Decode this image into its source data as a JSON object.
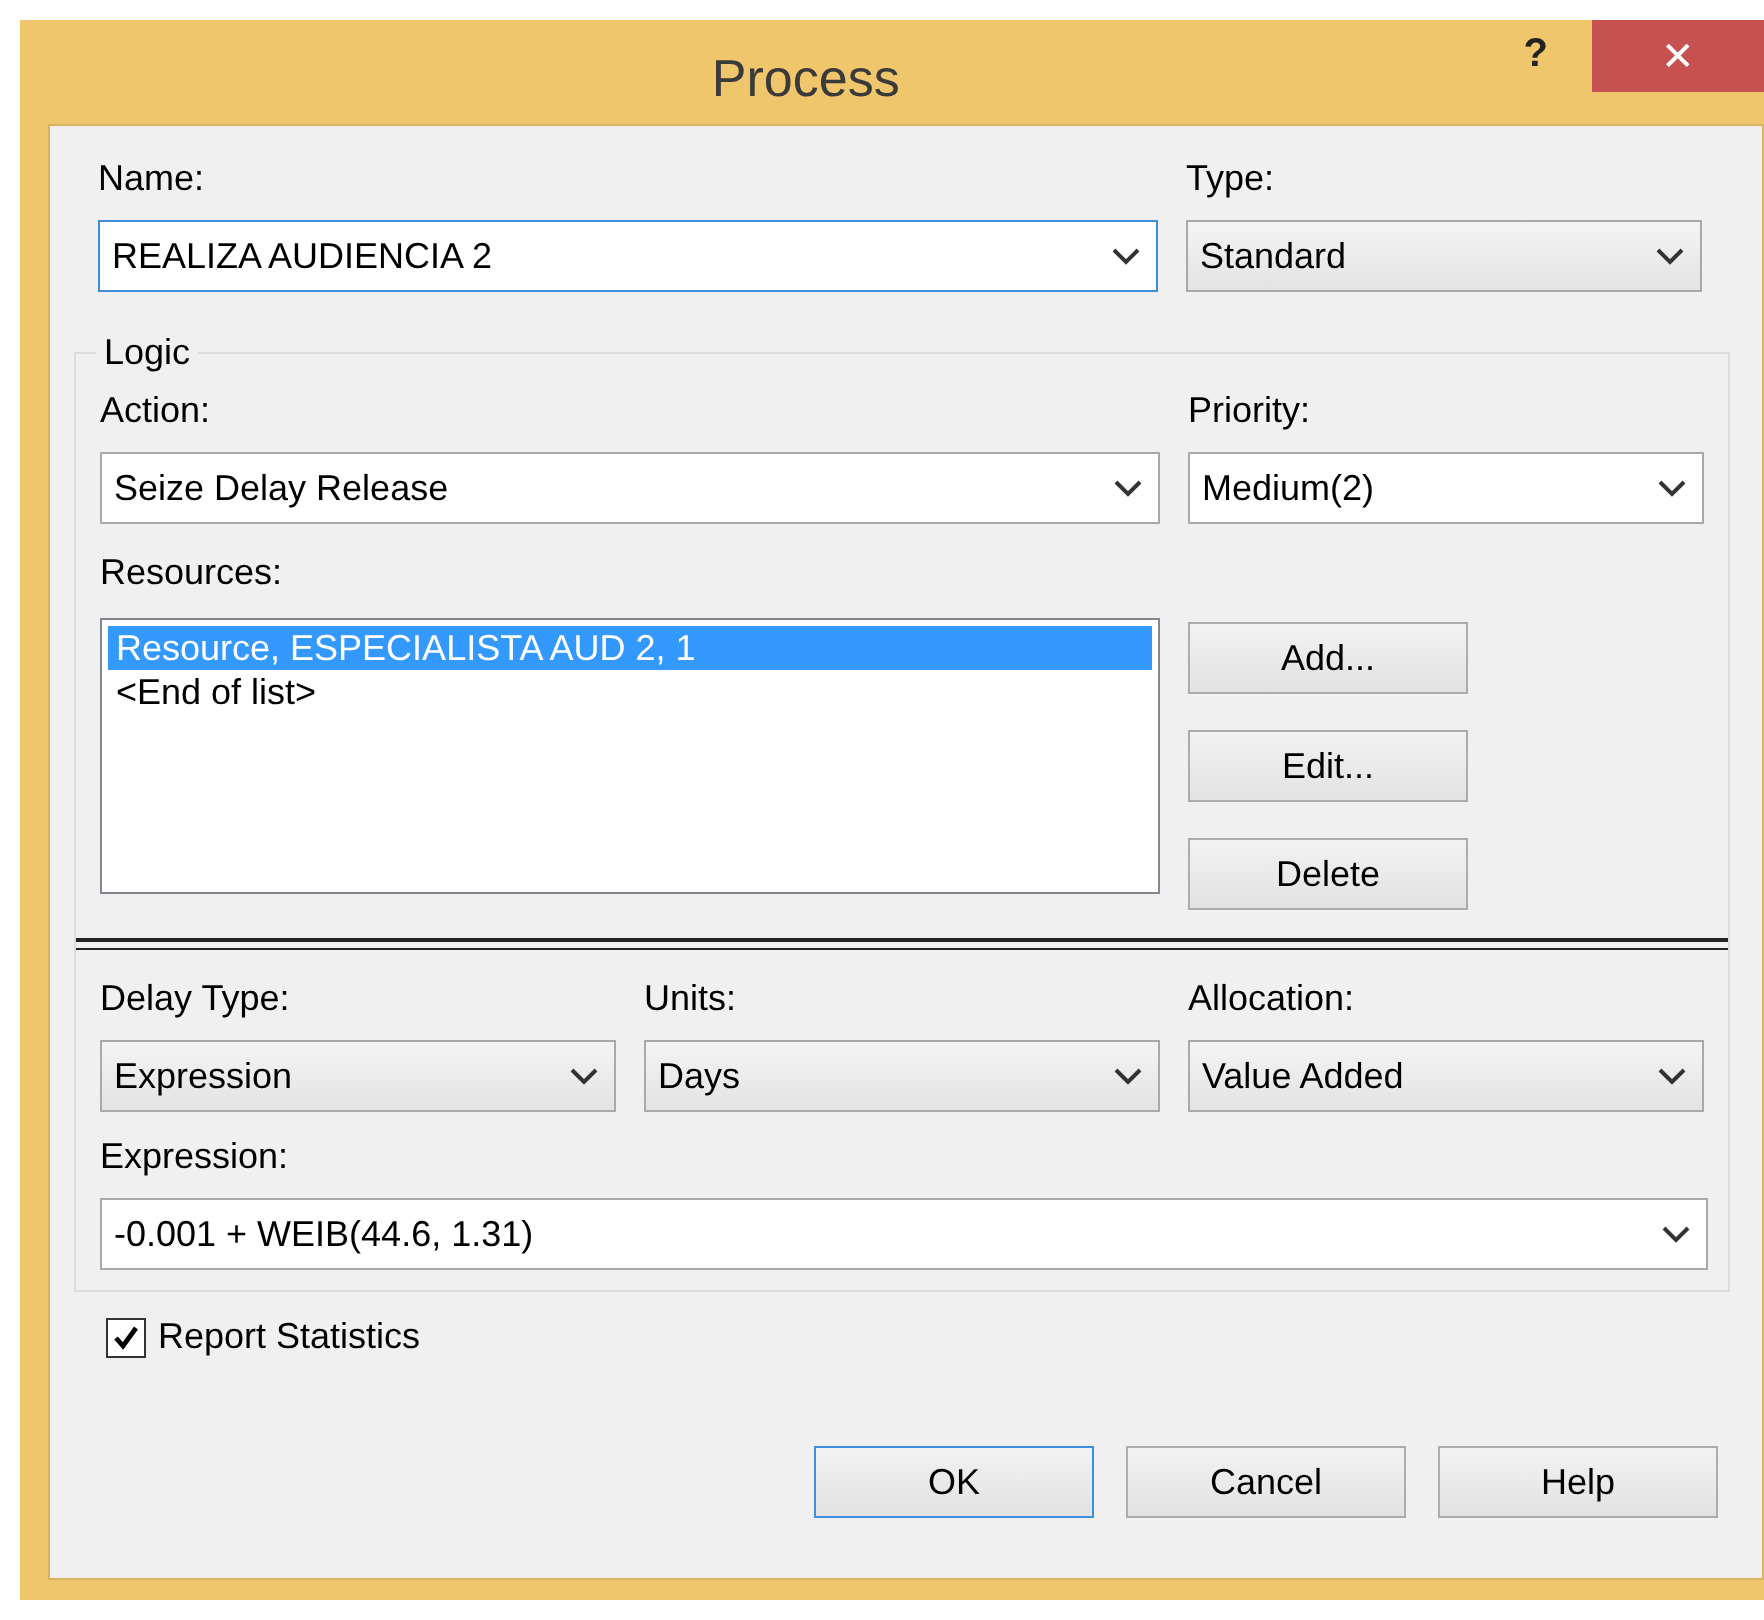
{
  "window": {
    "title": "Process",
    "help_glyph": "?",
    "close_glyph": "✕"
  },
  "name": {
    "label": "Name:",
    "value": "REALIZA AUDIENCIA 2",
    "kind": "combo",
    "focused": true
  },
  "type": {
    "label": "Type:",
    "value": "Standard",
    "kind": "list",
    "focused": false
  },
  "logic": {
    "title": "Logic",
    "action": {
      "label": "Action:",
      "value": "Seize Delay Release",
      "kind": "combo",
      "focused": false
    },
    "priority": {
      "label": "Priority:",
      "value": "Medium(2)",
      "kind": "combo",
      "focused": false
    },
    "resources": {
      "label": "Resources:",
      "items": [
        {
          "text": "Resource, ESPECIALISTA AUD 2, 1",
          "selected": true
        },
        {
          "text": "<End of list>",
          "selected": false
        }
      ]
    },
    "resource_buttons": [
      "Add...",
      "Edit...",
      "Delete"
    ],
    "delay_type": {
      "label": "Delay Type:",
      "value": "Expression",
      "kind": "list",
      "focused": false
    },
    "units": {
      "label": "Units:",
      "value": "Days",
      "kind": "list",
      "focused": false
    },
    "allocation": {
      "label": "Allocation:",
      "value": "Value Added",
      "kind": "list",
      "focused": false
    },
    "expression": {
      "label": "Expression:",
      "value": "-0.001 + WEIB(44.6, 1.31)",
      "kind": "combo",
      "focused": false
    }
  },
  "report_statistics": {
    "label": "Report Statistics",
    "checked": true
  },
  "buttons": [
    {
      "label": "OK",
      "default": true
    },
    {
      "label": "Cancel",
      "default": false
    },
    {
      "label": "Help",
      "default": false
    }
  ]
}
